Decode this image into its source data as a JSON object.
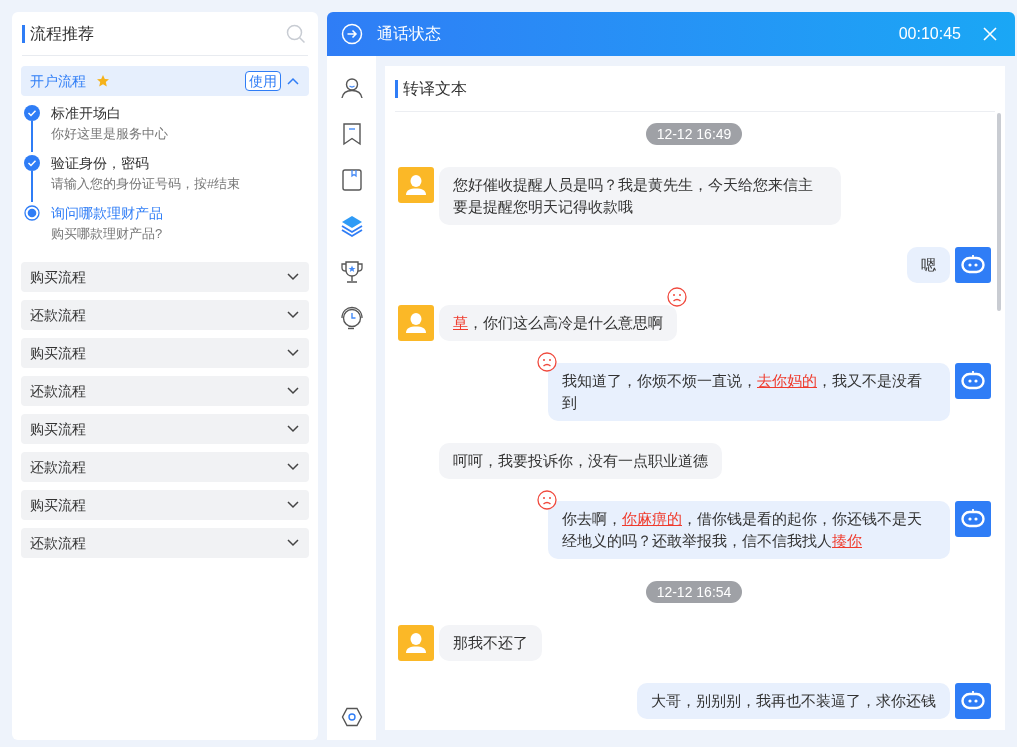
{
  "sidebar": {
    "title": "流程推荐",
    "flows": [
      {
        "label": "开户流程",
        "starred": true,
        "use_button": "使用",
        "expanded": true,
        "steps": [
          {
            "title": "标准开场白",
            "detail": "你好这里是服务中心",
            "completed": true
          },
          {
            "title": "验证身份，密码",
            "detail": "请输入您的身份证号码，按#结束",
            "completed": true
          },
          {
            "title": "询问哪款理财产品",
            "detail": "购买哪款理财产品?",
            "completed": false
          }
        ]
      },
      {
        "label": "购买流程",
        "starred": false,
        "expanded": false
      },
      {
        "label": "还款流程",
        "starred": false,
        "expanded": false
      },
      {
        "label": "购买流程",
        "starred": false,
        "expanded": false
      },
      {
        "label": "还款流程",
        "starred": false,
        "expanded": false
      },
      {
        "label": "购买流程",
        "starred": false,
        "expanded": false
      },
      {
        "label": "还款流程",
        "starred": false,
        "expanded": false
      },
      {
        "label": "购买流程",
        "starred": false,
        "expanded": false
      },
      {
        "label": "还款流程",
        "starred": false,
        "expanded": false
      }
    ]
  },
  "call": {
    "title": "通话状态",
    "timer": "00:10:45"
  },
  "toolbar": [
    {
      "kind": "person",
      "selected": false
    },
    {
      "kind": "bookmark",
      "selected": false
    },
    {
      "kind": "book",
      "selected": false
    },
    {
      "kind": "layers",
      "selected": true
    },
    {
      "kind": "trophy",
      "selected": false
    },
    {
      "kind": "headset",
      "selected": false
    }
  ],
  "transcript": {
    "title": "转译文本",
    "items": [
      {
        "kind": "time",
        "text": "12-12 16:49"
      },
      {
        "kind": "customer",
        "avatar": true,
        "negative": false,
        "parts": [
          {
            "text": "您好催收提醒人员是吗？我是黄先生，今天给您来信主要是提醒您明天记得收款哦",
            "flagged": false
          }
        ]
      },
      {
        "kind": "agent",
        "avatar": true,
        "negative": false,
        "parts": [
          {
            "text": "嗯",
            "flagged": false
          }
        ]
      },
      {
        "kind": "customer",
        "avatar": true,
        "negative": true,
        "parts": [
          {
            "text": "草",
            "flagged": true
          },
          {
            "text": "，你们这么高冷是什么意思啊",
            "flagged": false
          }
        ]
      },
      {
        "kind": "agent",
        "avatar": true,
        "negative": true,
        "parts": [
          {
            "text": "我知道了，你烦不烦一直说，",
            "flagged": false
          },
          {
            "text": "去你妈的",
            "flagged": true
          },
          {
            "text": "，我又不是没看到",
            "flagged": false
          }
        ]
      },
      {
        "kind": "customer",
        "avatar": false,
        "negative": false,
        "parts": [
          {
            "text": "呵呵，我要投诉你，没有一点职业道德",
            "flagged": false
          }
        ]
      },
      {
        "kind": "agent",
        "avatar": true,
        "negative": true,
        "parts": [
          {
            "text": "你去啊，",
            "flagged": false
          },
          {
            "text": "你麻痹的",
            "flagged": true
          },
          {
            "text": "，借你钱是看的起你，你还钱不是天经地义的吗？还敢举报我，信不信我找人",
            "flagged": false
          },
          {
            "text": "揍你",
            "flagged": true
          }
        ]
      },
      {
        "kind": "time",
        "text": "12-12 16:54"
      },
      {
        "kind": "customer",
        "avatar": true,
        "negative": false,
        "parts": [
          {
            "text": "那我不还了",
            "flagged": false
          }
        ]
      },
      {
        "kind": "agent",
        "avatar": true,
        "negative": false,
        "parts": [
          {
            "text": "大哥，别别别，我再也不装逼了，求你还钱",
            "flagged": false
          }
        ]
      }
    ]
  }
}
